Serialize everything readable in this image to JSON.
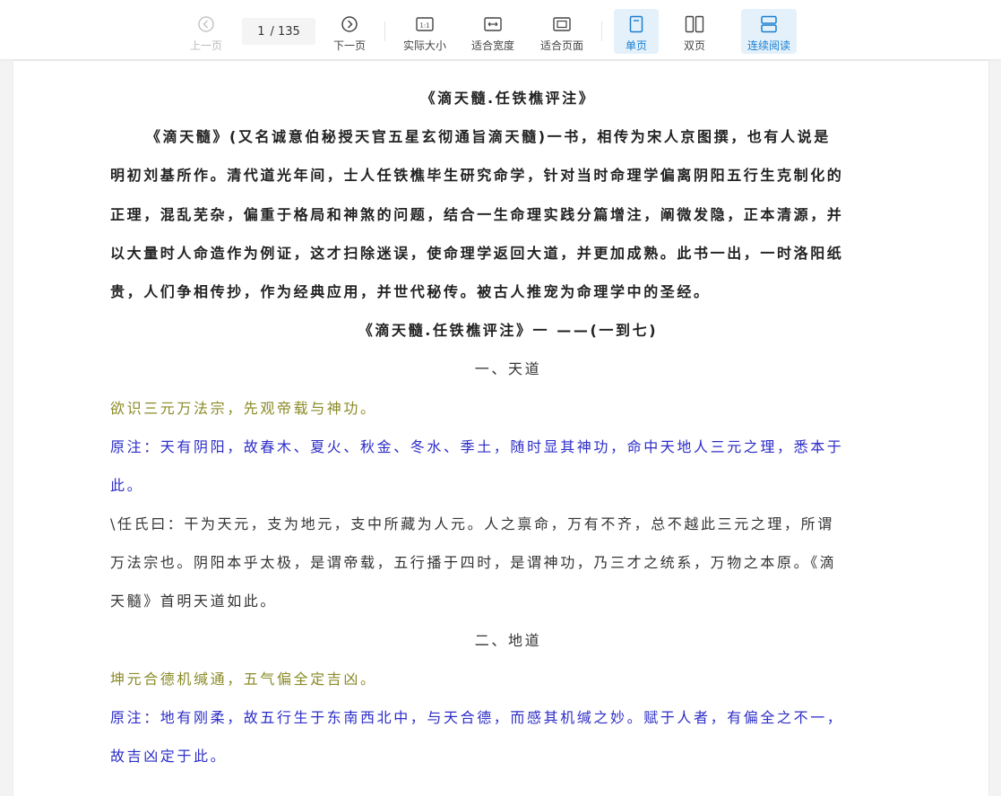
{
  "toolbar": {
    "prev": "上一页",
    "current_page": "1",
    "total_pages": "/ 135",
    "next": "下一页",
    "actual_size": "实际大小",
    "fit_width": "适合宽度",
    "fit_page": "适合页面",
    "single_page": "单页",
    "double_page": "双页",
    "continuous": "连续阅读",
    "accent_color": "#1a7fd0"
  },
  "document": {
    "title": "《滴天髓.任铁樵评注》",
    "intro": [
      "《滴天髓》(又名诚意伯秘授天官五星玄彻通旨滴天髓)一书，相传为宋人京图撰，也有人说是",
      "明初刘基所作。清代道光年间，士人任铁樵毕生研究命学，针对当时命理学偏离阴阳五行生克制化的",
      "正理，混乱芜杂，偏重于格局和神煞的问题，结合一生命理实践分篇增注，阐微发隐，正本清源，并",
      "以大量时人命造作为例证，这才扫除迷误，使命理学返回大道，并更加成熟。此书一出，一时洛阳纸",
      "贵，人们争相传抄，作为经典应用，并世代秘传。被古人推宠为命理学中的圣经。"
    ],
    "subtitle": "《滴天髓.任铁樵评注》一  ——(一到七)",
    "section1_heading": "一、天道",
    "section1_verse": "欲识三元万法宗，先观帝载与神功。",
    "section1_note": [
      "原注：天有阴阳，故春木、夏火、秋金、冬水、季土，随时显其神功，命中天地人三元之理，悉本于",
      "此。"
    ],
    "section1_commentary": [
      "\\任氏曰：干为天元，支为地元，支中所藏为人元。人之禀命，万有不齐，总不越此三元之理，所谓",
      "万法宗也。阴阳本乎太极，是谓帝载，五行播于四时，是谓神功，乃三才之统系，万物之本原。《滴",
      "天髓》首明天道如此。"
    ],
    "section2_heading": "二、地道",
    "section2_verse": "坤元合德机缄通，五气偏全定吉凶。",
    "section2_note": [
      "原注：地有刚柔，故五行生于东南西北中，与天合德，而感其机缄之妙。赋于人者，有偏全之不一，",
      "故吉凶定于此。"
    ]
  },
  "icons": {
    "prev": "chevron-left-circle-icon",
    "next": "chevron-right-circle-icon",
    "actual_size": "one-to-one-icon",
    "fit_width": "fit-width-icon",
    "fit_page": "fit-page-icon",
    "single_page": "single-page-icon",
    "double_page": "double-page-icon",
    "continuous": "continuous-read-icon"
  }
}
